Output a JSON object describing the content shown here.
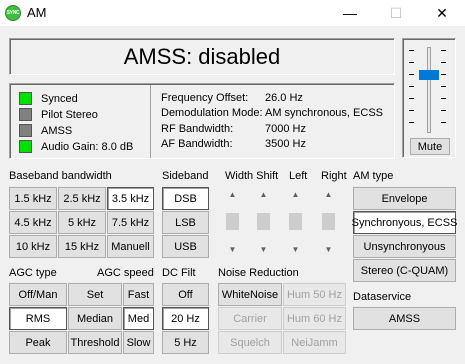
{
  "window": {
    "icon_label": "SYNC",
    "title": "AM",
    "minimize": "—",
    "maximize": "☐",
    "close": "✕"
  },
  "status": {
    "text": "AMSS: disabled"
  },
  "indicators": [
    {
      "label": "Synced",
      "color": "#00e000"
    },
    {
      "label": "Pilot Stereo",
      "color": "#808080"
    },
    {
      "label": "AMSS",
      "color": "#808080"
    },
    {
      "label": "Audio Gain: 8.0 dB",
      "color": "#00e000"
    }
  ],
  "info": {
    "freq_offset_label": "Frequency Offset:",
    "freq_offset_value": "26.0 Hz",
    "demod_label": "Demodulation Mode:",
    "demod_value": "AM synchronous, ECSS",
    "rf_label": "RF Bandwidth:",
    "rf_value": "7000 Hz",
    "af_label": "AF Bandwidth:",
    "af_value": "3500 Hz"
  },
  "volume": {
    "mute_label": "Mute",
    "level": 0.7
  },
  "baseband": {
    "title": "Baseband bandwidth",
    "buttons": [
      "1.5 kHz",
      "2.5 kHz",
      "3.5 kHz",
      "4.5 kHz",
      "5 kHz",
      "7.5 kHz",
      "10 kHz",
      "15 kHz",
      "Manuell"
    ]
  },
  "sideband": {
    "title": "Sideband",
    "buttons": [
      "DSB",
      "LSB",
      "USB"
    ]
  },
  "sliders": {
    "width_shift_label": "Width Shift",
    "left_label": "Left",
    "right_label": "Right"
  },
  "am_type": {
    "title": "AM type",
    "buttons": [
      "Envelope",
      "Synchronyous, ECSS",
      "Unsynchronyous",
      "Stereo (C-QUAM)"
    ]
  },
  "agc_type": {
    "title": "AGC type",
    "buttons": [
      "Off/Man",
      "RMS",
      "Peak"
    ]
  },
  "agc_speed": {
    "title": "AGC speed",
    "buttons": [
      "Set",
      "Fast",
      "Median",
      "Med",
      "Threshold",
      "Slow"
    ]
  },
  "dc_filt": {
    "title": "DC Filt",
    "buttons": [
      "Off",
      "20 Hz",
      "5 Hz"
    ]
  },
  "noise_reduction": {
    "title": "Noise Reduction",
    "buttons": [
      "WhiteNoise",
      "Hum 50 Hz",
      "Carrier",
      "Hum 60 Hz",
      "Squelch",
      "NeiJamm"
    ]
  },
  "dataservice": {
    "title": "Dataservice",
    "button": "AMSS"
  }
}
